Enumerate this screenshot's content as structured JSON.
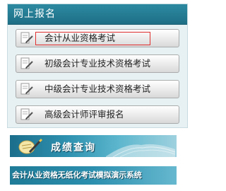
{
  "panel": {
    "title": "网上报名",
    "items": [
      {
        "label": "会计从业资格考试",
        "icon": "document-pencil-icon",
        "highlighted": true
      },
      {
        "label": "初级会计专业技术资格考试",
        "icon": "document-pencil-icon",
        "highlighted": false
      },
      {
        "label": "中级会计专业技术资格考试",
        "icon": "document-pencil-icon",
        "highlighted": false
      },
      {
        "label": "高级会计师评审报名",
        "icon": "document-pencil-icon",
        "highlighted": false
      }
    ]
  },
  "banners": {
    "score_query": {
      "label": "成绩查询",
      "icon": "pen-paper-icon"
    },
    "simulation": {
      "label": "会计从业资格无纸化考试模拟演示系统"
    }
  },
  "colors": {
    "header": "#2c8aa1",
    "panel_bg": "#e7f1f3",
    "highlight_border": "#e0302f",
    "banner_blue": "#1b6e8c"
  }
}
